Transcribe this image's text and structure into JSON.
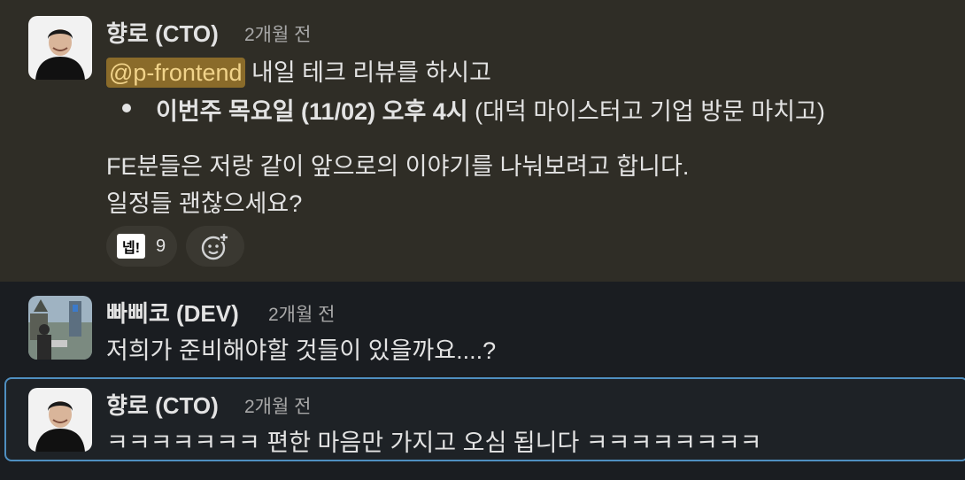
{
  "messages": [
    {
      "author": "향로 (CTO)",
      "time": "2개월 전",
      "mention": "@p-frontend",
      "line1_rest": " 내일 테크 리뷰를 하시고",
      "bullet_bold": "이번주 목요일 (11/02) 오후 4시",
      "bullet_rest": " (대덕 마이스터고 기업 방문 마치고)",
      "para1": "FE분들은 저랑 같이 앞으로의 이야기를 나눠보려고 합니다.",
      "para2": "일정들 괜찮으세요?",
      "reaction_label": "넵!",
      "reaction_count": "9",
      "add_reaction_icon": "add-emoji-icon"
    },
    {
      "author": "빠삐코 (DEV)",
      "time": "2개월 전",
      "text": "저희가 준비해야할 것들이 있을까요....?"
    },
    {
      "author": "향로 (CTO)",
      "time": "2개월 전",
      "text": "ㅋㅋㅋㅋㅋㅋㅋ 편한 마음만 가지고 오심 됩니다 ㅋㅋㅋㅋㅋㅋㅋㅋ"
    }
  ],
  "colors": {
    "highlight_bg": "#2f2d26",
    "mention_bg": "#8a6b2a",
    "mention_text": "#f1d38a",
    "focus_border": "#4f8fc0"
  }
}
